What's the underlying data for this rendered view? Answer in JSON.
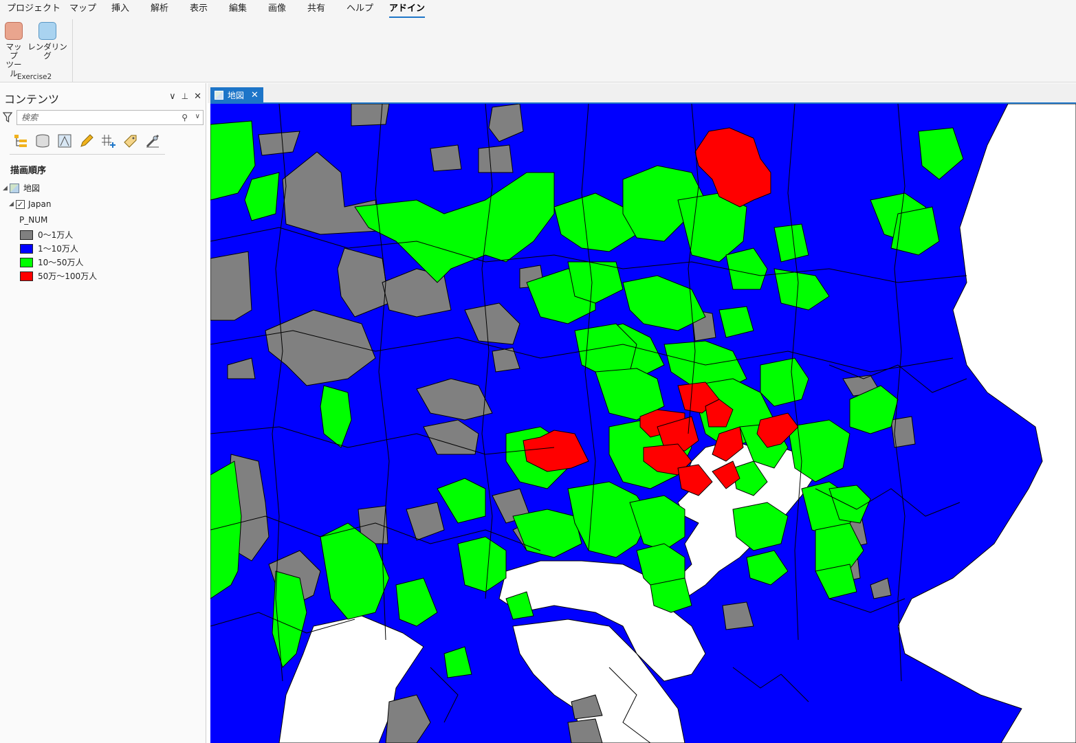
{
  "ribbon": {
    "tabs": [
      "プロジェクト",
      "マップ",
      "挿入",
      "解析",
      "表示",
      "編集",
      "画像",
      "共有",
      "ヘルプ",
      "アドイン"
    ],
    "active_tab": "アドイン",
    "buttons": {
      "map_tool_line1": "マップ",
      "map_tool_line2": "ツール",
      "rendering": "レンダリング"
    },
    "group_label": "Exercise2"
  },
  "contents": {
    "title": "コンテンツ",
    "ctrl_dropdown": "∨",
    "ctrl_pin": "🖈",
    "ctrl_close": "✕",
    "search_placeholder": "検索",
    "section": "描画順序",
    "map_name": "地図",
    "layer_name": "Japan",
    "field": "P_NUM",
    "legend": [
      {
        "label": "0〜1万人",
        "color": "#808080"
      },
      {
        "label": "1〜10万人",
        "color": "#0000ff"
      },
      {
        "label": "10〜50万人",
        "color": "#00ff00"
      },
      {
        "label": "50万〜100万人",
        "color": "#ff0000"
      }
    ]
  },
  "view_tab": {
    "label": "地図",
    "close": "✕"
  },
  "colors": {
    "accent": "#1d75c8",
    "gray": "#808080",
    "blue": "#0000ff",
    "green": "#00ff00",
    "red": "#ff0000"
  }
}
